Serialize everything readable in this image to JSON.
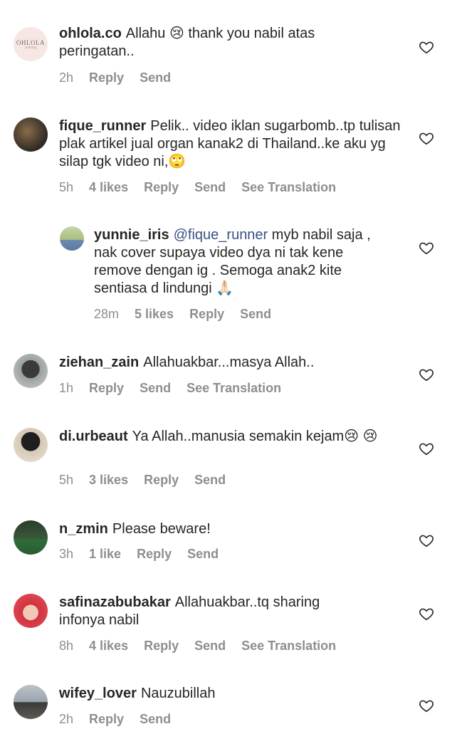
{
  "comments": [
    {
      "username": "ohlola.co",
      "text": "Allahu 😢 thank you nabil atas peringatan..",
      "time": "2h",
      "likes": "",
      "reply": "Reply",
      "send": "Send",
      "translation": "",
      "avatar_text": "OHLOLA",
      "avatar_subtext": "clothing"
    },
    {
      "username": "fique_runner",
      "text": "Pelik.. video iklan sugarbomb..tp tulisan plak artikel jual organ kanak2 di Thailand..ke aku yg silap tgk video ni,🙄",
      "time": "5h",
      "likes": "4 likes",
      "reply": "Reply",
      "send": "Send",
      "translation": "See Translation"
    },
    {
      "username": "yunnie_iris",
      "mention": "@fique_runner",
      "text": "myb nabil saja , nak cover supaya video dya ni tak kene remove dengan ig . Semoga anak2 kite sentiasa d lindungi 🙏🏻",
      "time": "28m",
      "likes": "5 likes",
      "reply": "Reply",
      "send": "Send",
      "translation": ""
    },
    {
      "username": "ziehan_zain",
      "text": "Allahuakbar...masya Allah..",
      "time": "1h",
      "likes": "",
      "reply": "Reply",
      "send": "Send",
      "translation": "See Translation"
    },
    {
      "username": "di.urbeaut",
      "text": "Ya Allah..manusia semakin kejam😢 😢",
      "time": "5h",
      "likes": "3 likes",
      "reply": "Reply",
      "send": "Send",
      "translation": ""
    },
    {
      "username": "n_zmin",
      "text": "Please beware!",
      "time": "3h",
      "likes": "1 like",
      "reply": "Reply",
      "send": "Send",
      "translation": ""
    },
    {
      "username": "safinazabubakar",
      "text": "Allahuakbar..tq sharing infonya nabil",
      "time": "8h",
      "likes": "4 likes",
      "reply": "Reply",
      "send": "Send",
      "translation": "See Translation"
    },
    {
      "username": "wifey_lover",
      "text": "Nauzubillah",
      "time": "2h",
      "likes": "",
      "reply": "Reply",
      "send": "Send",
      "translation": ""
    }
  ],
  "icons": {
    "like": "heart-outline-icon"
  },
  "colors": {
    "meta": "#8e8e8e",
    "mention": "#385185",
    "text": "#262626"
  }
}
